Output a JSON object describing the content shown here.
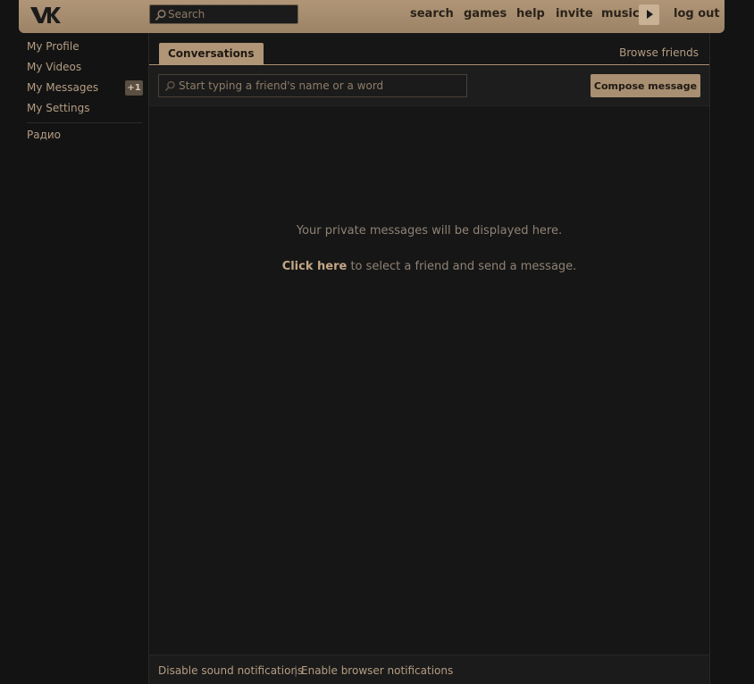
{
  "header": {
    "logo_text": "VK",
    "search_placeholder": "Search",
    "nav": [
      "search",
      "games",
      "help",
      "invite",
      "music",
      "log out"
    ]
  },
  "sidebar": {
    "items": [
      {
        "label": "My Profile"
      },
      {
        "label": "My Videos"
      },
      {
        "label": "My Messages",
        "badge": "+1"
      },
      {
        "label": "My Settings"
      }
    ],
    "extra": "Радио"
  },
  "main": {
    "tab_label": "Conversations",
    "browse_friends": "Browse friends",
    "filter_placeholder": "Start typing a friend's name or a word",
    "compose_label": "Compose message",
    "empty_text": "Your private messages will be displayed here.",
    "click_here": "Click here",
    "click_suffix": " to select a friend and send a message.",
    "footer": {
      "disable_sound": "Disable sound notifications",
      "separator": "|",
      "enable_browser": "Enable browser notifications"
    }
  },
  "colors": {
    "accent": "#b09677",
    "background": "#131313"
  },
  "icons": [
    "vk-logo-icon",
    "search-icon",
    "play-icon"
  ]
}
